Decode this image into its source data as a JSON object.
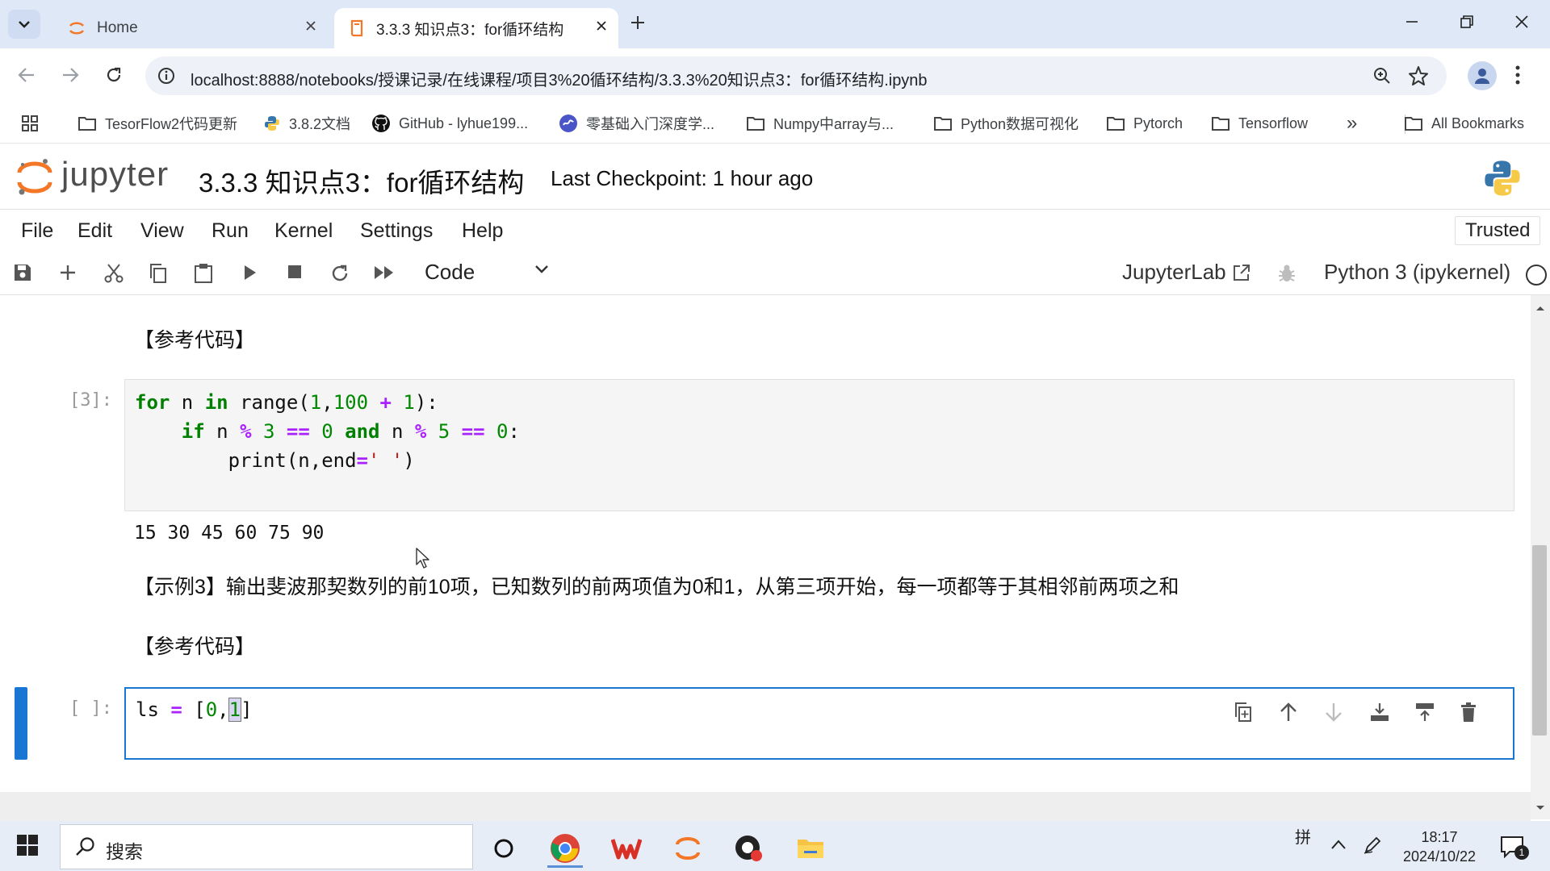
{
  "browser": {
    "tabs": [
      {
        "label": "Home",
        "active": false
      },
      {
        "label": "3.3.3 知识点3：for循环结构",
        "active": true
      }
    ],
    "url": "localhost:8888/notebooks/授课记录/在线课程/项目3%20循环结构/3.3.3%20知识点3：for循环结构.ipynb",
    "bookmarks": [
      "TesorFlow2代码更新",
      "3.8.2文档",
      "GitHub - lyhue199...",
      "零基础入门深度学...",
      "Numpy中array与...",
      "Python数据可视化",
      "Pytorch",
      "Tensorflow",
      "All Bookmarks"
    ],
    "bookmarks_more": "»"
  },
  "jupyter": {
    "logo_text": "jupyter",
    "notebook_title": "3.3.3 知识点3：for循环结构",
    "checkpoint": "Last Checkpoint: 1 hour ago",
    "menu": [
      "File",
      "Edit",
      "View",
      "Run",
      "Kernel",
      "Settings",
      "Help"
    ],
    "trusted": "Trusted",
    "cell_type": "Code",
    "jupyterlab_label": "JupyterLab",
    "kernel_name": "Python 3 (ipykernel)"
  },
  "notebook": {
    "md1": "【参考代码】",
    "cell1_prompt": "[3]:",
    "cell1_code": [
      "for n in range(1,100 + 1):",
      "    if n % 3 == 0 and n % 5 == 0:",
      "        print(n,end=' ')"
    ],
    "cell1_output": "15 30 45 60 75 90",
    "md2": "【示例3】输出斐波那契数列的前10项，已知数列的前两项值为0和1，从第三项开始，每一项都等于其相邻前两项之和",
    "md3": "【参考代码】",
    "cell2_prompt": "[ ]:",
    "cell2_code": "ls = [0,1]"
  },
  "taskbar": {
    "search_placeholder": "搜索",
    "ime": "拼",
    "time": "18:17",
    "date": "2024/10/22",
    "notifications": "1"
  }
}
